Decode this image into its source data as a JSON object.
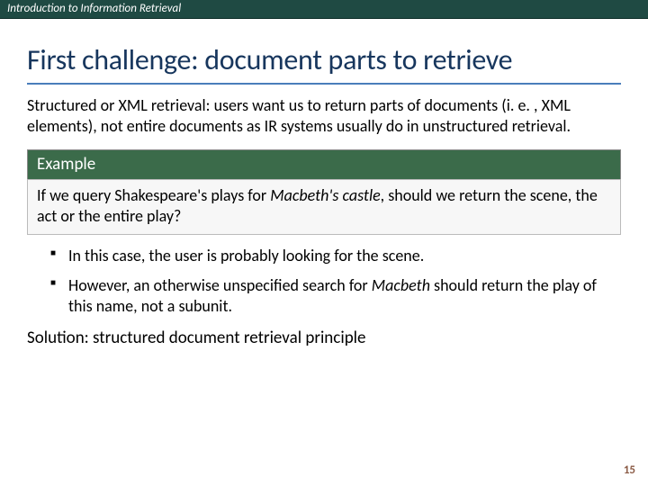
{
  "header": "Introduction to Information Retrieval",
  "title": "First challenge: document parts to retrieve",
  "intro": "Structured or XML retrieval: users want us to return parts of documents  (i. e. , XML elements), not entire documents as IR systems usually do in unstructured retrieval.",
  "example": {
    "label": "Example",
    "body_pre": "If  we query Shakespeare's plays for ",
    "body_em": "Macbeth's castle",
    "body_post": ", should we return the scene, the act or the entire play?"
  },
  "bullets": [
    {
      "text": "In this case, the user is probably looking for the scene."
    },
    {
      "pre": "However, an otherwise unspecified search for ",
      "em": "Macbeth",
      "post": " should return the play of this name, not a subunit."
    }
  ],
  "solution": "Solution: structured document retrieval principle",
  "page_number": "15"
}
